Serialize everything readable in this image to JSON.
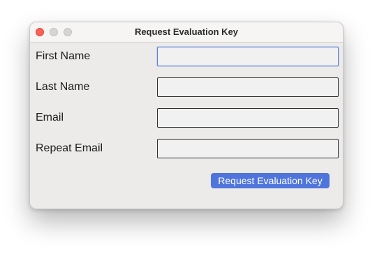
{
  "window": {
    "title": "Request Evaluation Key"
  },
  "form": {
    "fields": [
      {
        "label": "First Name",
        "value": "",
        "focused": true
      },
      {
        "label": "Last Name",
        "value": ""
      },
      {
        "label": "Email",
        "value": ""
      },
      {
        "label": "Repeat Email",
        "value": ""
      }
    ],
    "submit_label": "Request Evaluation Key"
  },
  "colors": {
    "accent": "#4f75dc",
    "close_button": "#fe5f57",
    "focus_ring": "#5b7fd6"
  }
}
